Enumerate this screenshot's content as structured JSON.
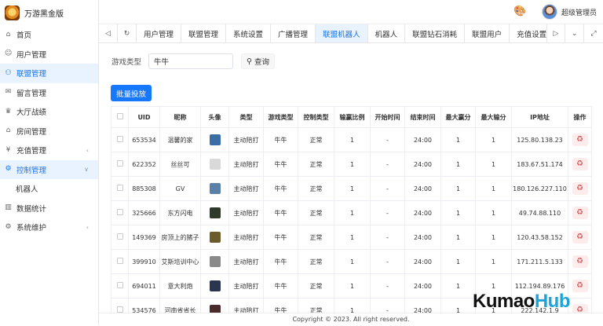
{
  "brand": {
    "title": "万游黑金版"
  },
  "sidebar": {
    "items": [
      {
        "label": "首页",
        "icon": "home-icon",
        "glyph": "⌂",
        "active": false
      },
      {
        "label": "用户管理",
        "icon": "user-icon",
        "glyph": "☺",
        "active": false
      },
      {
        "label": "联盟管理",
        "icon": "group-icon",
        "glyph": "⚇",
        "active": true
      },
      {
        "label": "留言管理",
        "icon": "message-icon",
        "glyph": "✉",
        "active": false
      },
      {
        "label": "大厅战绩",
        "icon": "trophy-icon",
        "glyph": "♛",
        "active": false
      },
      {
        "label": "房间管理",
        "icon": "room-icon",
        "glyph": "⌂",
        "active": false
      },
      {
        "label": "充值管理",
        "icon": "recharge-icon",
        "glyph": "¥",
        "active": false,
        "arrow": "‹"
      },
      {
        "label": "控制管理",
        "icon": "control-icon",
        "glyph": "⚙",
        "active": true,
        "arrow": "∨"
      },
      {
        "label": "机器人",
        "sub": true
      },
      {
        "label": "数据统计",
        "icon": "chart-icon",
        "glyph": "▥",
        "active": false
      },
      {
        "label": "系统维护",
        "icon": "settings-icon",
        "glyph": "⚙",
        "active": false,
        "arrow": "‹"
      }
    ]
  },
  "header": {
    "username": "超级管理员"
  },
  "tabs": [
    "用户管理",
    "联盟管理",
    "系统设置",
    "广播管理",
    "联盟机器人",
    "机器人",
    "联盟钻石消耗",
    "联盟用户",
    "充值设置"
  ],
  "tabs_active_index": 4,
  "filter": {
    "label": "游戏类型",
    "value": "牛牛",
    "query_label": "查询"
  },
  "batch_label": "批量投放",
  "table": {
    "headers": [
      "",
      "UID",
      "昵称",
      "头像",
      "类型",
      "游戏类型",
      "控制类型",
      "输赢比例",
      "开始时间",
      "结束时间",
      "最大赢分",
      "最大输分",
      "IP地址",
      "操作"
    ],
    "rows": [
      [
        "653534",
        "温馨的家",
        "主动陪打",
        "牛牛",
        "正常",
        "1",
        "-",
        "24:00",
        "1",
        "1",
        "125.80.138.23"
      ],
      [
        "622352",
        "丝丝可",
        "主动陪打",
        "牛牛",
        "正常",
        "1",
        "-",
        "24:00",
        "1",
        "1",
        "183.67.51.174"
      ],
      [
        "885308",
        "GV",
        "主动陪打",
        "牛牛",
        "正常",
        "1",
        "-",
        "24:00",
        "1",
        "1",
        "180.126.227.110"
      ],
      [
        "325666",
        "东方闪电",
        "主动陪打",
        "牛牛",
        "正常",
        "1",
        "-",
        "24:00",
        "1",
        "1",
        "49.74.88.110"
      ],
      [
        "149369",
        "房顶上的猪子",
        "主动陪打",
        "牛牛",
        "正常",
        "1",
        "-",
        "24:00",
        "1",
        "1",
        "120.43.58.152"
      ],
      [
        "399910",
        "艾斯培训中心",
        "主动陪打",
        "牛牛",
        "正常",
        "1",
        "-",
        "24:00",
        "1",
        "1",
        "171.211.5.133"
      ],
      [
        "694011",
        "意大利炮",
        "主动陪打",
        "牛牛",
        "正常",
        "1",
        "-",
        "24:00",
        "1",
        "1",
        "112.194.89.176"
      ],
      [
        "534576",
        "河南省省长",
        "主动陪打",
        "牛牛",
        "正常",
        "1",
        "-",
        "24:00",
        "1",
        "1",
        "222.142.1.9"
      ]
    ],
    "avatar_colors": [
      "#3a6ea5",
      "#d9d9d9",
      "#5a7fa8",
      "#2f3a2a",
      "#6b5a2a",
      "#8a8a8a",
      "#2a3550",
      "#4a2a2a"
    ]
  },
  "footer": {
    "text": "Copyright © 2023. All right reserved."
  },
  "watermark": {
    "text": "Kumao",
    "accent": "Hub"
  },
  "colors": {
    "accent": "#1677ff",
    "active_bg": "#e8f3ff",
    "delete": "#e05555"
  }
}
